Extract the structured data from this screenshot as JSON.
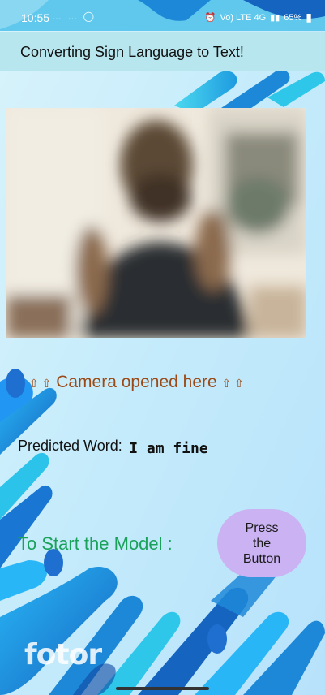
{
  "status_bar": {
    "time": "10:55",
    "left_icons": "… … ◯",
    "network_label": "Vo) LTE 4G",
    "battery_percent": "65%"
  },
  "app_bar": {
    "title": "Converting Sign Language to Text!"
  },
  "camera": {
    "arrows_left": "⇧ ⇧",
    "caption": "Camera opened here",
    "arrows_right": "⇧ ⇧"
  },
  "prediction": {
    "label": "Predicted Word:",
    "value": "I am fine"
  },
  "start": {
    "label": "To Start the Model :",
    "button_line1": "Press",
    "button_line2": "the",
    "button_line3": "Button"
  },
  "watermark": "fotor",
  "colors": {
    "background": "#c9ecfa",
    "app_bar": "#b8e6ee",
    "caption": "#9b4a17",
    "start_label": "#1aa15a",
    "button": "#cbb3f3",
    "accent_blue": "#1e88d8"
  }
}
